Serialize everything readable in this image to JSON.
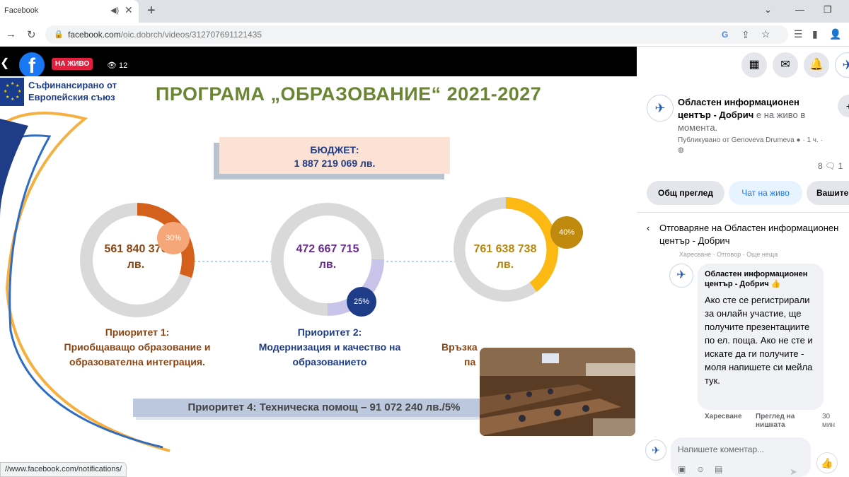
{
  "browser": {
    "tab_title": "Facebook",
    "tab_audio_icon": "speaker-icon",
    "new_tab_icon": "plus-icon",
    "url_host": "facebook.com",
    "url_path": "/oic.dobrch/videos/312707691121435",
    "status_url": "https://www.facebook.com/notifications/"
  },
  "video": {
    "live_badge": "НА ЖИВО",
    "viewer_count": "12",
    "status_bar_url": "//www.facebook.com/notifications/"
  },
  "slide": {
    "eu_line1": "Съфинансирано от",
    "eu_line2": "Европейския съюз",
    "title": "ПРОГРАМА „ОБРАЗОВАНИЕ“ 2021-2027",
    "budget_label": "БЮДЖЕТ:",
    "budget_value": "1 887 219 069 лв.",
    "rings": [
      {
        "amount": "561 840 376",
        "unit": "лв.",
        "percent_label": "30%",
        "percent": 30,
        "color": "#d4601c",
        "text_color": "#8b4513",
        "badge_color": "#f6a77a",
        "badge_text": "#fff"
      },
      {
        "amount": "472 667 715",
        "unit": "лв.",
        "percent_label": "25%",
        "percent": 25,
        "color": "#c8c4ea",
        "text_color": "#6a2c91",
        "badge_color": "#1f3c88",
        "badge_text": "#fff"
      },
      {
        "amount": "761 638 738",
        "unit": "лв.",
        "percent_label": "40%",
        "percent": 40,
        "color": "#fdb913",
        "text_color": "#b8860b",
        "badge_color": "#bf8a0e",
        "badge_text": "#fff"
      }
    ],
    "priorities": [
      {
        "line1": "Приоритет 1:",
        "line2": "Приобщаващо образование и",
        "line3": "образователна интеграция.",
        "color": "#8b4513"
      },
      {
        "line1": "Приоритет 2:",
        "line2": "Модернизация и качество на",
        "line3": "образованието",
        "color": "#1f3c88"
      },
      {
        "line1": "Връзка",
        "line2": "па",
        "color": "#8b4513"
      }
    ],
    "priority4": "Приоритет 4: Техническа помощ – 91 072 240 лв./5%"
  },
  "panel": {
    "page_name_bold": "Областен информационен център - Добрич",
    "live_suffix": " е на живо в момента.",
    "published_by": "Публикувано от Genoveva Drumeva",
    "time_ago": "1 ч.",
    "comment_count": "8",
    "share_count_partial": "1",
    "tabs": [
      {
        "label": "Общ преглед",
        "active": false
      },
      {
        "label": "Чат на живо",
        "active": true
      },
      {
        "label": "Вашите",
        "active": false
      }
    ],
    "reply_header": "Отговаряне на Областен информационен център - Добрич",
    "faded_actions": "Харесване · Отговор · Още неща",
    "comment": {
      "author": "Областен информационен център - Добрич",
      "author_emoji": "👍",
      "text": "Ако сте се регистрирали за онлайн участие, ще получите презентациите по ел. поща. Ако не сте и искате да ги получите - моля напишете си мейла тук.",
      "like_label": "Харесване",
      "view_label": "Преглед на нишката",
      "time": "30 мин"
    },
    "comment_placeholder": "Напишете коментар..."
  }
}
